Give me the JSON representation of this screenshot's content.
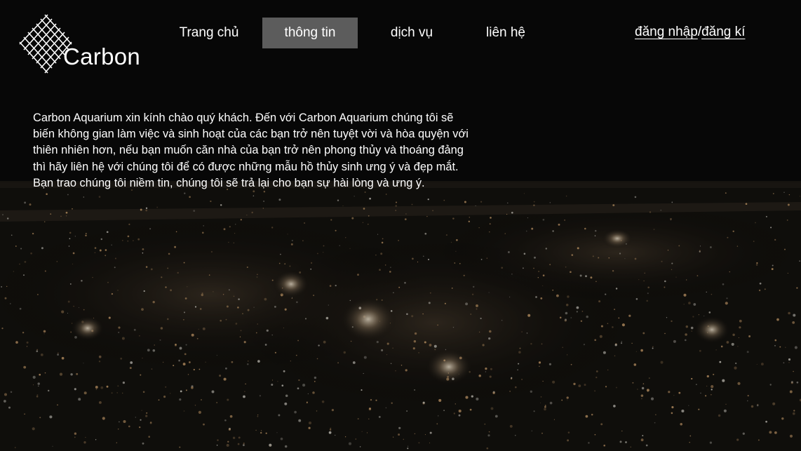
{
  "brand": {
    "name": "Carbon",
    "logo_icon": "crosshatch-diamond-icon"
  },
  "nav": {
    "items": [
      {
        "label": "Trang chủ",
        "active": false
      },
      {
        "label": "thông tin",
        "active": true
      },
      {
        "label": "dịch vụ",
        "active": false
      },
      {
        "label": "liên hệ",
        "active": false
      }
    ]
  },
  "auth": {
    "login": "đăng nhập",
    "separator": "/",
    "register": "đăng kí"
  },
  "intro": {
    "lines": [
      "Carbon Aquarium xin kính chào quý khách. Đến với Carbon Aquarium chúng tôi sẽ",
      "biến không gian làm việc và sinh hoạt của các bạn trở nên tuyệt vời và hòa quyện với",
      "thiên nhiên hơn, nếu bạn muốn căn nhà của bạn trở nên phong thủy và thoáng đảng",
      "thì hãy liên hệ với chúng tôi để có được những mẫu hồ thủy sinh ưng ý và đẹp mắt.",
      "Bạn trao chúng tôi niềm tin, chúng tôi sẽ trả lại cho bạn sự hài lòng và ưng ý."
    ]
  },
  "colors": {
    "active_tab": "#5c5c5c",
    "text": "#ffffff",
    "background": "#0a0a0a",
    "city_light": "#e8b070"
  }
}
